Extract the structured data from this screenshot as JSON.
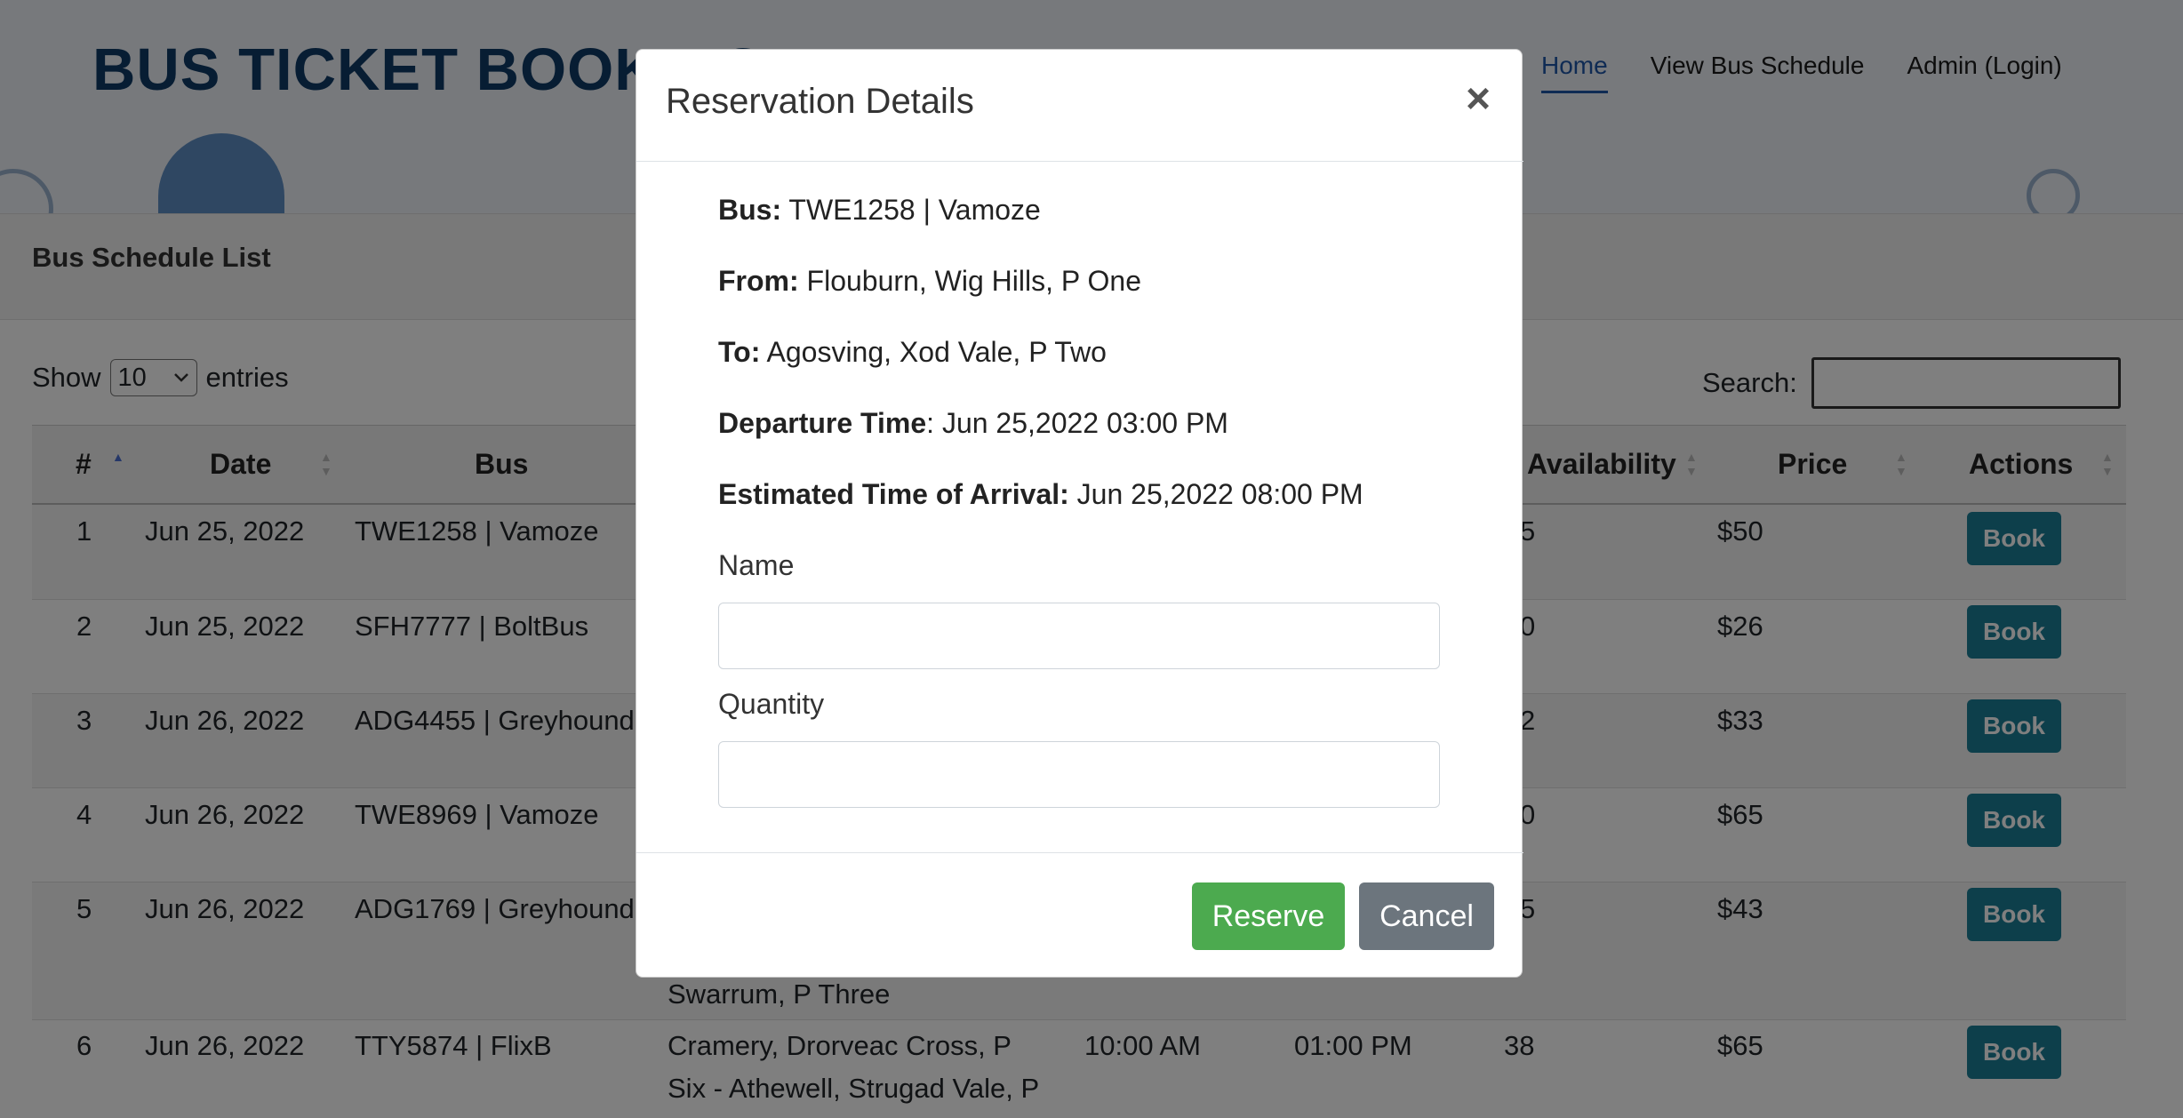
{
  "app": {
    "brand": "BUS TICKET BOOKING"
  },
  "nav": [
    {
      "label": "Home"
    },
    {
      "label": "View Bus Schedule"
    },
    {
      "label": "Admin (Login)"
    }
  ],
  "schedule": {
    "title": "Bus Schedule List",
    "show_label": "Show",
    "entries_value": "10",
    "entries_label": "entries",
    "search_label": "Search:",
    "columns": [
      "#",
      "Date",
      "Bus",
      "Availability",
      "Price",
      "Actions"
    ],
    "rows": [
      {
        "num": "1",
        "date": "Jun 25, 2022",
        "bus": "TWE1258 | Vamoze",
        "avail": "5",
        "price": "$50",
        "action": "Book"
      },
      {
        "num": "2",
        "date": "Jun 25, 2022",
        "bus": "SFH7777 | BoltBus",
        "avail": "0",
        "price": "$26",
        "action": "Book"
      },
      {
        "num": "3",
        "date": "Jun 26, 2022",
        "bus": "ADG4455 | Greyhound",
        "avail": "2",
        "price": "$33",
        "action": "Book"
      },
      {
        "num": "4",
        "date": "Jun 26, 2022",
        "bus": "TWE8969 | Vamoze",
        "avail": "0",
        "price": "$65",
        "action": "Book"
      },
      {
        "num": "5",
        "date": "Jun 26, 2022",
        "bus": "ADG1769 | Greyhound",
        "avail": "5",
        "price": "$43",
        "action": "Book",
        "route_tail": "Swarrum, P Three"
      },
      {
        "num": "6",
        "date": "Jun 26, 2022",
        "bus": "TTY5874 | FlixB",
        "route_1": "Cramery, Drorveac Cross, P",
        "route_2": "Six - Athewell, Strugad Vale, P",
        "depart": "10:00 AM",
        "arrive": "01:00 PM",
        "avail": "38",
        "price": "$65",
        "action": "Book"
      }
    ]
  },
  "modal": {
    "title": "Reservation Details",
    "close_glyph": "×",
    "bus_label": "Bus:",
    "bus_value": "TWE1258 | Vamoze",
    "from_label": "From:",
    "from_value": "Flouburn, Wig Hills, P One",
    "to_label": "To:",
    "to_value": "Agosving, Xod Vale, P Two",
    "departure_label": "Departure Time",
    "departure_value": ": Jun 25,2022 03:00 PM",
    "eta_label": "Estimated Time of Arrival:",
    "eta_value": "Jun 25,2022 08:00 PM",
    "name_label": "Name",
    "name_value": "",
    "quantity_label": "Quantity",
    "quantity_value": "",
    "reserve_label": "Reserve",
    "cancel_label": "Cancel"
  }
}
